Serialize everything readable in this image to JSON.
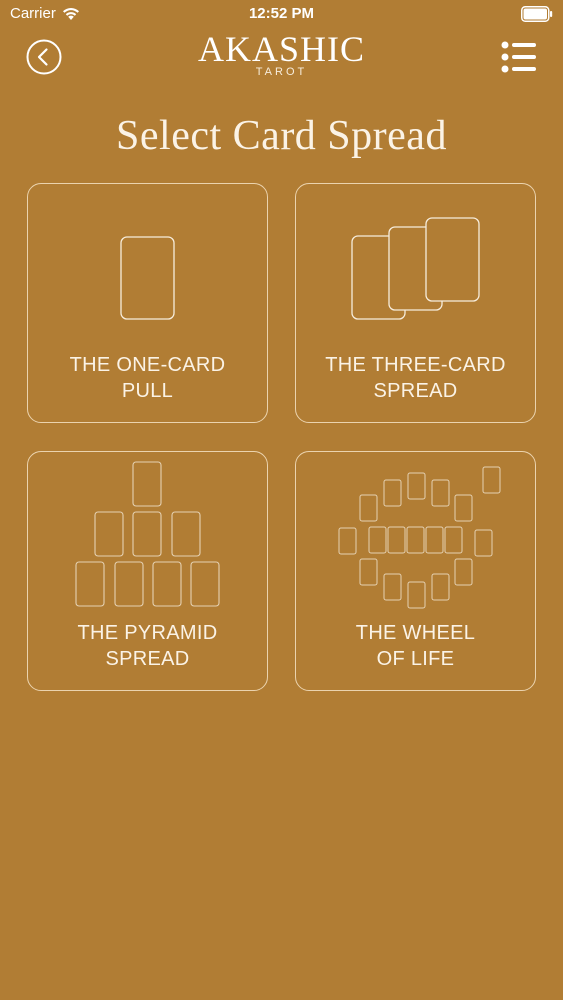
{
  "status_bar": {
    "carrier": "Carrier",
    "time": "12:52 PM"
  },
  "header": {
    "brand_title": "AKASHIC",
    "brand_subtitle": "TAROT",
    "back_icon": "chevron-left-circle-icon",
    "menu_icon": "list-menu-icon"
  },
  "page": {
    "title": "Select Card Spread"
  },
  "spreads": [
    {
      "line1": "THE ONE-CARD",
      "line2": "PULL"
    },
    {
      "line1": "THE THREE-CARD",
      "line2": "SPREAD"
    },
    {
      "line1": "THE PYRAMID",
      "line2": "SPREAD"
    },
    {
      "line1": "THE WHEEL",
      "line2": "OF LIFE"
    }
  ],
  "colors": {
    "background": "#b17d34",
    "line": "#f7eddc"
  }
}
